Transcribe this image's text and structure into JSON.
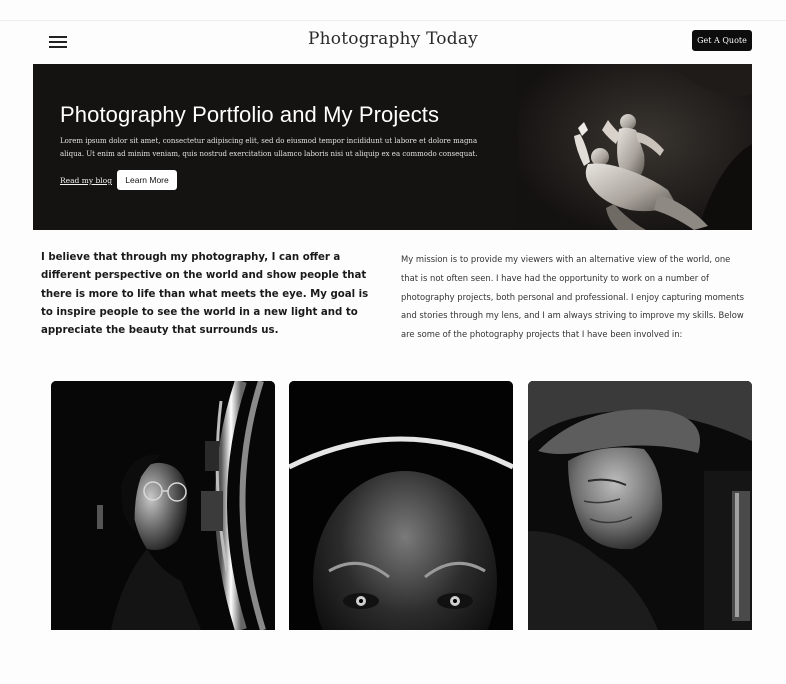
{
  "header": {
    "title": "Photography Today",
    "quote_button": "Get A Quote",
    "menu_icon": "hamburger-menu-icon"
  },
  "hero": {
    "title": "Photography Portfolio and My Projects",
    "text": "Lorem ipsum dolor sit amet, consectetur adipiscing elit, sed do eiusmod tempor incididunt ut labore et dolore magna aliqua. Ut enim ad minim veniam, quis nostrud exercitation ullamco laboris nisi ut aliquip ex ea commodo consequat.",
    "link_label": "Read my blog",
    "button_label": "Learn More",
    "background_color": "#151312"
  },
  "intro": {
    "statement": "I believe that through my photography, I can offer a different perspective on the world and show people that there is more to life than what meets the eye. My goal is to inspire people to see the world in a new light and to appreciate the beauty that surrounds us.",
    "mission": "My mission is to provide my viewers with an alternative view of the world, one that is not often seen. I have had the opportunity to work on a number of photography projects, both personal and professional. I enjoy capturing moments and stories through my lens, and I am always striving to improve my skills. Below are some of the photography projects that I have been involved in:"
  },
  "gallery": {
    "items": [
      {
        "subject": "woman-with-glasses-and-neon-ring-photo"
      },
      {
        "subject": "face-under-ring-light-photo"
      },
      {
        "subject": "elderly-man-in-cap-photo"
      }
    ]
  }
}
